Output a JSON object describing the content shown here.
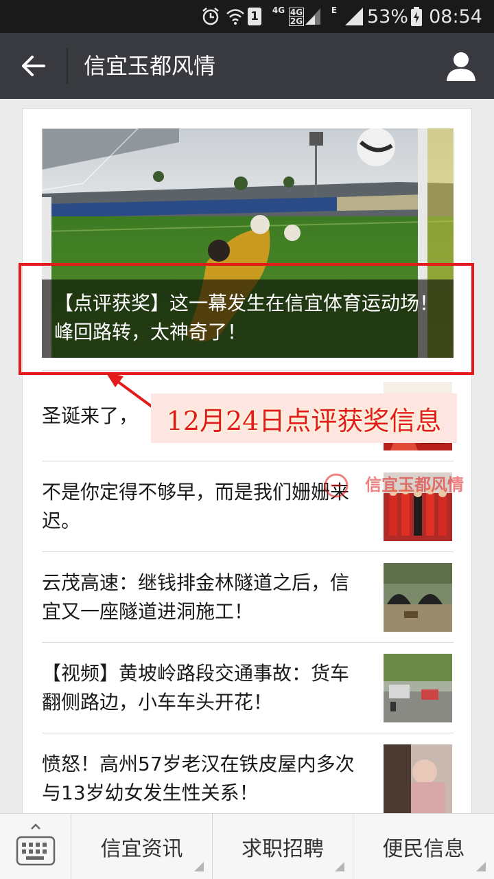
{
  "status_bar": {
    "signal_1": "1",
    "network_4g": "4G",
    "network_4g2g_top": "4G",
    "network_4g2g_bottom": "2G",
    "network_e": "E",
    "battery": "53%",
    "time": "08:54"
  },
  "header": {
    "title": "信宜玉都风情",
    "icons": [
      "back-arrow-icon",
      "profile-icon"
    ]
  },
  "hero": {
    "caption": "【点评获奖】这一幕发生在信宜体育运动场！峰回路转，太神奇了！"
  },
  "annotation": {
    "label": "12月24日点评获奖信息",
    "color": "#e21b1b"
  },
  "articles": [
    {
      "title": "圣诞来了，"
    },
    {
      "title": "不是你定得不够早，而是我们姗姗来迟。"
    },
    {
      "title": "云茂高速：继钱排金林隧道之后，信宜又一座隧道进洞施工！"
    },
    {
      "title": "【视频】黄坡岭路段交通事故：货车翻侧路边，小车车头开花！"
    },
    {
      "title": "愤怒！高州57岁老汉在铁皮屋内多次与13岁幼女发生性关系！"
    }
  ],
  "watermark": {
    "text": "信宜玉都风情"
  },
  "tab_bar": {
    "tabs": [
      {
        "label": "信宜资讯"
      },
      {
        "label": "求职招聘"
      },
      {
        "label": "便民信息"
      }
    ]
  },
  "colors": {
    "status_bar_bg": "#1a1a1a",
    "nav_bg": "#393a3f",
    "page_bg": "#ebebeb",
    "highlight": "#e21b1b"
  }
}
